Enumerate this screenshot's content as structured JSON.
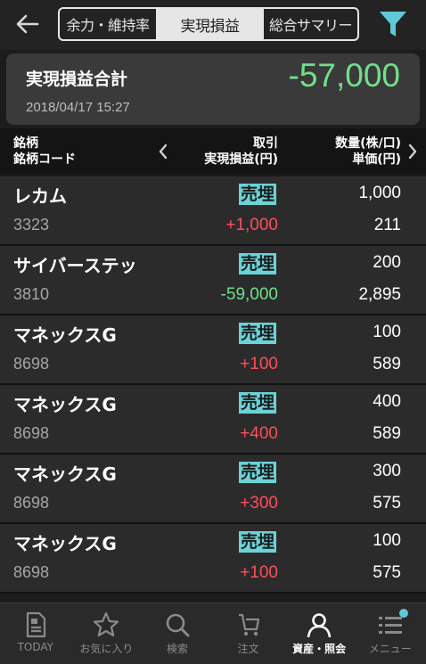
{
  "header": {
    "back_icon": "back-arrow-icon",
    "tabs": [
      {
        "label": "余力・維持率",
        "active": false
      },
      {
        "label": "実現損益",
        "active": true
      },
      {
        "label": "総合サマリー",
        "active": false
      }
    ],
    "filter_icon": "filter-icon",
    "accent_color": "#5fc9d6"
  },
  "summary": {
    "title": "実現損益合計",
    "value": "-57,000",
    "datetime": "2018/04/17  15:27",
    "value_color": "#6fe08a"
  },
  "columns": {
    "c1_line1": "銘柄",
    "c1_line2": "銘柄コード",
    "c2_line1": "取引",
    "c2_line2": "実現損益(円)",
    "c3_line1": "数量(株/口)",
    "c3_line2": "単価(円)"
  },
  "rows": [
    {
      "name": "レカム",
      "code": "3323",
      "type": "売埋",
      "pl": "+1,000",
      "qty": "1,000",
      "price": "211",
      "sign": "pos"
    },
    {
      "name": "サイバーステッ",
      "code": "3810",
      "type": "売埋",
      "pl": "-59,000",
      "qty": "200",
      "price": "2,895",
      "sign": "neg"
    },
    {
      "name": "マネックスG",
      "code": "8698",
      "type": "売埋",
      "pl": "+100",
      "qty": "100",
      "price": "589",
      "sign": "pos"
    },
    {
      "name": "マネックスG",
      "code": "8698",
      "type": "売埋",
      "pl": "+400",
      "qty": "400",
      "price": "589",
      "sign": "pos"
    },
    {
      "name": "マネックスG",
      "code": "8698",
      "type": "売埋",
      "pl": "+300",
      "qty": "300",
      "price": "575",
      "sign": "pos"
    },
    {
      "name": "マネックスG",
      "code": "8698",
      "type": "売埋",
      "pl": "+100",
      "qty": "100",
      "price": "575",
      "sign": "pos"
    }
  ],
  "bottom_nav": [
    {
      "label": "TODAY",
      "icon": "document-icon",
      "active": false
    },
    {
      "label": "お気に入り",
      "icon": "star-icon",
      "active": false
    },
    {
      "label": "検索",
      "icon": "search-icon",
      "active": false
    },
    {
      "label": "注文",
      "icon": "cart-icon",
      "active": false
    },
    {
      "label": "資産・照会",
      "icon": "person-icon",
      "active": true
    },
    {
      "label": "メニュー",
      "icon": "menu-icon",
      "active": false,
      "badge": true
    }
  ]
}
